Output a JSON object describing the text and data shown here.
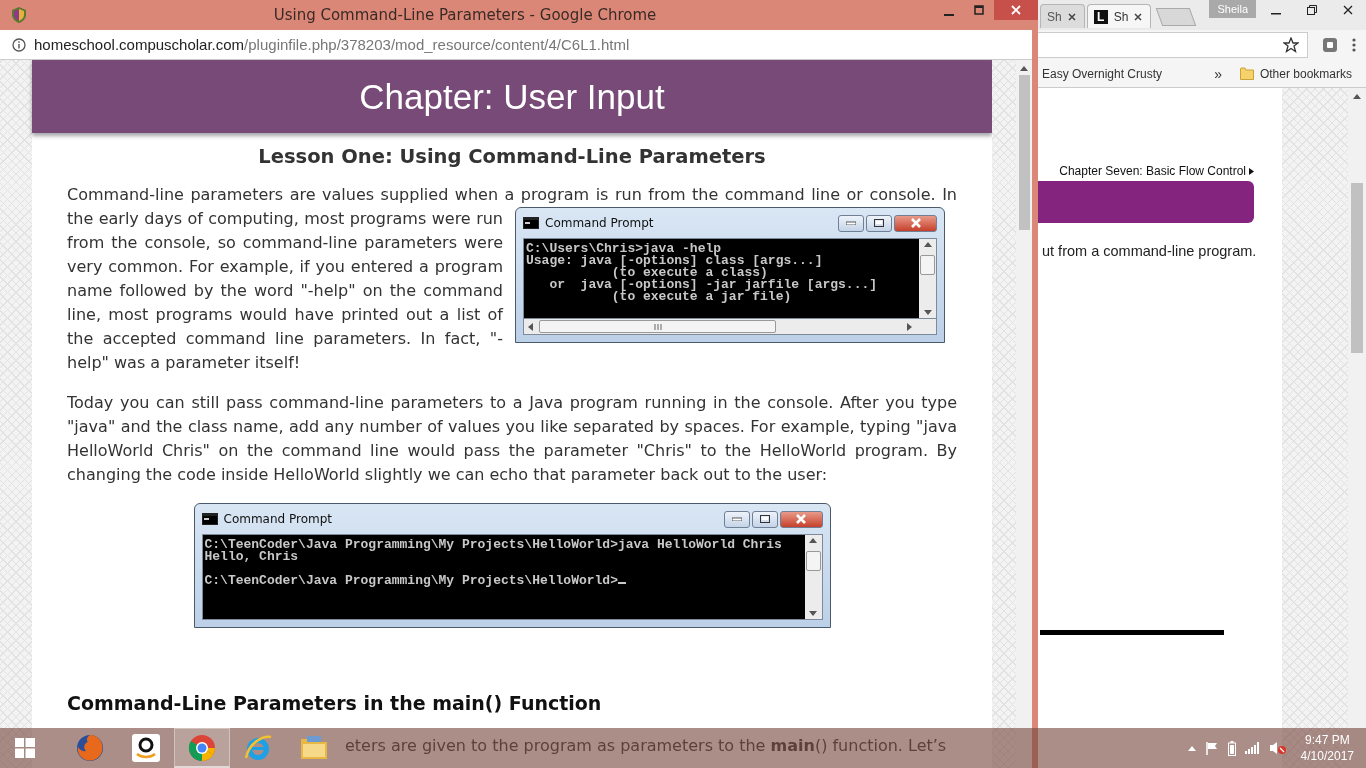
{
  "main_window": {
    "title": "Using Command-Line Parameters - Google Chrome",
    "address": {
      "host": "homeschool.compuscholar.com",
      "path": "/pluginfile.php/378203/mod_resource/content/4/C6L1.html"
    },
    "page": {
      "chapter_title": "Chapter: User Input",
      "lesson_title": "Lesson One: Using Command-Line Parameters",
      "blocks": [
        {
          "kind": "paragraph",
          "text": "Command-line parameters are values supplied when a program is run from the command line or console. In",
          "continuation": "the early days of computing, most programs were run from the console, so command-line parameters were very common. For example, if you entered a program name followed by the word \"-help\" on the command line, most programs would have printed out a list of the accepted command line parameters. In fact, \"-help\" was a parameter itself!",
          "figure": {
            "title": "Command Prompt",
            "groups": [
              [
                "C:\\Users\\Chris>java -help",
                "Usage: java [-options] class [args...]",
                "           (to execute a class)",
                "   or  java [-options] -jar jarfile [args...]",
                "           (to execute a jar file)"
              ]
            ]
          }
        },
        {
          "kind": "paragraph",
          "text": "Today you can still pass command-line parameters to a Java program running in the console.  After you type \"java\" and the class name, add any number of values you like separated by spaces. For example, typing \"java HelloWorld Chris\" on the command line would pass the parameter \"Chris\" to the HelloWorld program.  By changing the code inside HelloWorld slightly we can echo that parameter back out to the user:"
        },
        {
          "kind": "console",
          "title": "Command Prompt",
          "cursor": true,
          "groups": [
            [
              "C:\\TeenCoder\\Java Programming\\My Projects\\HelloWorld>java HelloWorld Chris",
              "Hello, Chris"
            ],
            [
              "C:\\TeenCoder\\Java Programming\\My Projects\\HelloWorld>"
            ]
          ]
        },
        {
          "kind": "heading",
          "text": "Command-Line Parameters in the main() Function"
        },
        {
          "kind": "partial",
          "text": "eters are given to the program as parameters to the **main**() function. Let’s"
        }
      ]
    }
  },
  "background_window": {
    "tabs": [
      {
        "label": "Sh",
        "selected": false
      },
      {
        "icon": "L",
        "label": "Sh",
        "selected": true
      }
    ],
    "user": "Sheila",
    "bookmarks": [
      {
        "label": "Easy Overnight Crusty"
      }
    ],
    "overflow": "»",
    "other_bookmarks": "Other bookmarks",
    "page": {
      "breadcrumb": "Chapter Seven: Basic Flow Control",
      "text": "ut from a command-line program."
    }
  },
  "taskbar": {
    "apps": [
      {
        "kind": "firefox",
        "selected": false
      },
      {
        "kind": "amazon",
        "selected": false
      },
      {
        "kind": "chrome",
        "selected": true
      },
      {
        "kind": "ie",
        "selected": false
      },
      {
        "kind": "explorer",
        "selected": false
      }
    ],
    "time": "9:47 PM",
    "date": "4/10/2017"
  }
}
